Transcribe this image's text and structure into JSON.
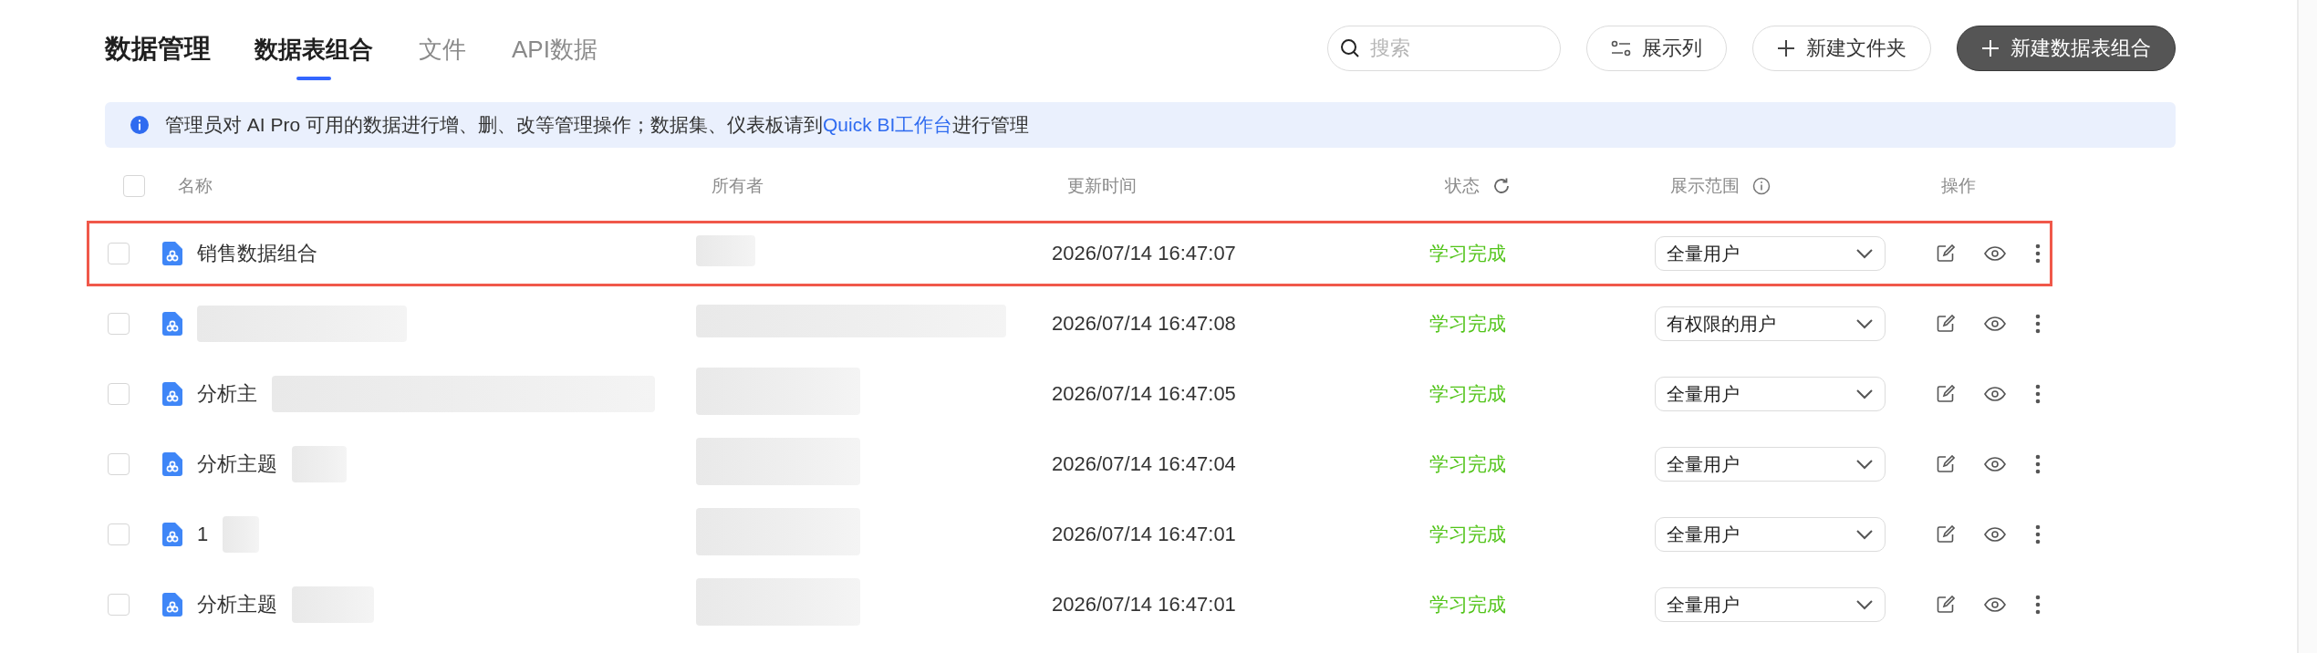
{
  "header": {
    "title": "数据管理",
    "tabs": [
      {
        "label": "数据表组合",
        "selected": true
      },
      {
        "label": "文件",
        "selected": false
      },
      {
        "label": "API数据",
        "selected": false
      }
    ],
    "search": {
      "placeholder": "搜索"
    },
    "buttons": [
      {
        "kind": "columns",
        "label": "展示列"
      },
      {
        "kind": "folder",
        "label": "新建文件夹"
      },
      {
        "kind": "primary",
        "label": "新建数据表组合"
      }
    ]
  },
  "notice": {
    "text": "管理员对 AI Pro 可用的数据进行增、删、改等管理操作；数据集、仪表板请到",
    "link": "Quick BI工作台",
    "suffix": "进行管理"
  },
  "table": {
    "select_all_checked": false,
    "columns": [
      "名称",
      "所有者",
      "更新时间",
      "状态",
      "展示范围",
      "操作"
    ],
    "rows": [
      {
        "checked": false,
        "highlighted": true,
        "name": "销售数据组合",
        "name_redacted": false,
        "owner_redacted": true,
        "updated": "2026/07/14 16:47:07",
        "status": "学习完成",
        "scope": "全量用户"
      },
      {
        "checked": false,
        "highlighted": false,
        "name_redacted": true,
        "owner_redacted": true,
        "updated": "2026/07/14 16:47:08",
        "status": "学习完成",
        "scope": "有权限的用户"
      },
      {
        "checked": false,
        "highlighted": false,
        "name": "分析主",
        "name_redacted": true,
        "owner_redacted": true,
        "updated": "2026/07/14 16:47:05",
        "status": "学习完成",
        "scope": "全量用户"
      },
      {
        "checked": false,
        "highlighted": false,
        "name": "分析主题",
        "name_redacted": true,
        "owner_redacted": true,
        "updated": "2026/07/14 16:47:04",
        "status": "学习完成",
        "scope": "全量用户"
      },
      {
        "checked": false,
        "highlighted": false,
        "name": "1",
        "name_redacted": true,
        "owner_redacted": true,
        "updated": "2026/07/14 16:47:01",
        "status": "学习完成",
        "scope": "全量用户"
      },
      {
        "checked": false,
        "highlighted": false,
        "name": "分析主题",
        "name_redacted": true,
        "owner_redacted": true,
        "updated": "2026/07/14 16:47:01",
        "status": "学习完成",
        "scope": "全量用户"
      }
    ]
  }
}
